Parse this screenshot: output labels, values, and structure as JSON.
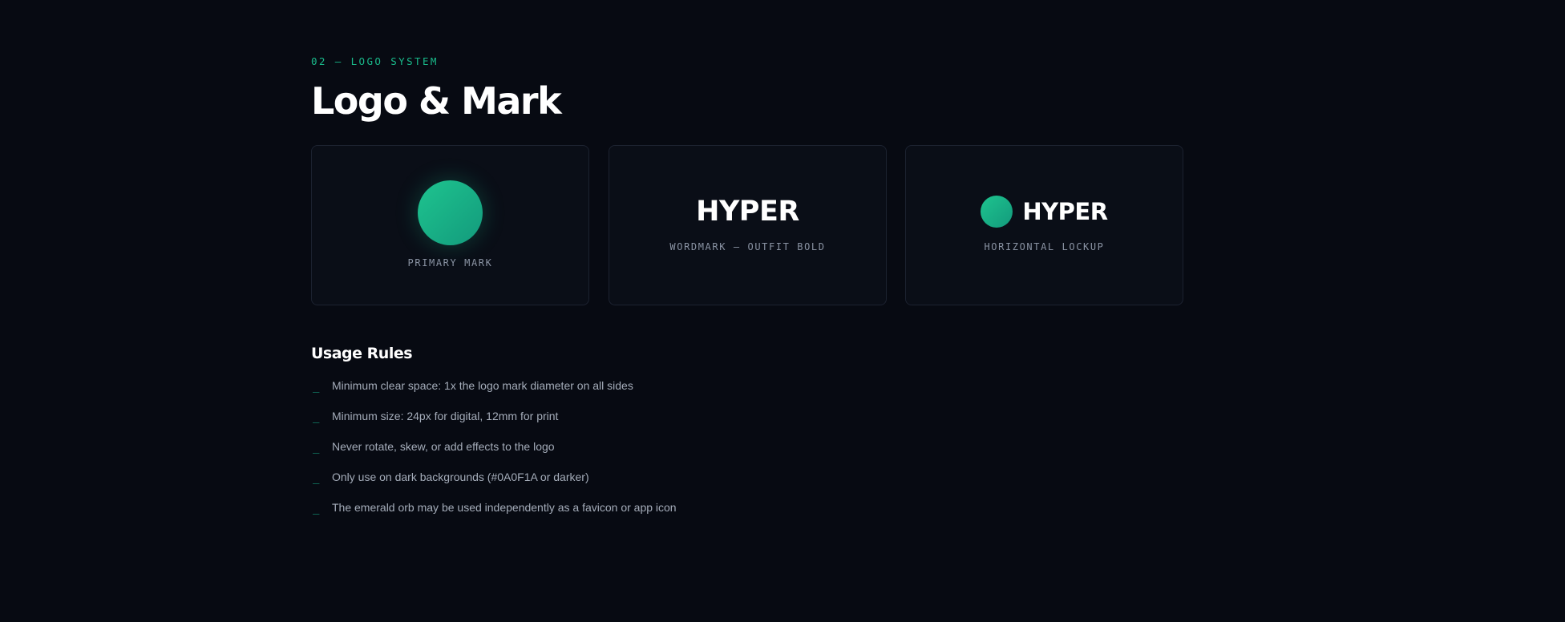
{
  "section": {
    "eyebrow": "02 — LOGO SYSTEM",
    "title": "Logo & Mark"
  },
  "cards": [
    {
      "caption": "PRIMARY MARK",
      "mark": "emerald-orb"
    },
    {
      "wordmark": "HYPER",
      "caption": "WORDMARK — OUTFIT BOLD"
    },
    {
      "lockup_word": "HYPER",
      "caption": "HORIZONTAL LOCKUP",
      "mark": "emerald-orb"
    }
  ],
  "rules": {
    "title": "Usage Rules",
    "bullet": "_",
    "items": [
      "Minimum clear space: 1x the logo mark diameter on all sides",
      "Minimum size: 24px for digital, 12mm for print",
      "Never rotate, skew, or add effects to the logo",
      "Only use on dark backgrounds (#0A0F1A or darker)",
      "The emerald orb may be used independently as a favicon or app icon"
    ]
  },
  "colors": {
    "background": "#070a12",
    "card_background": "#0a0e17",
    "card_border": "#1c2230",
    "accent": "#19b98a",
    "orb_start": "#1ec48f",
    "orb_end": "#139a7c",
    "text_primary": "#ffffff",
    "text_muted": "#8a93a3",
    "text_body": "#a4acb9"
  }
}
